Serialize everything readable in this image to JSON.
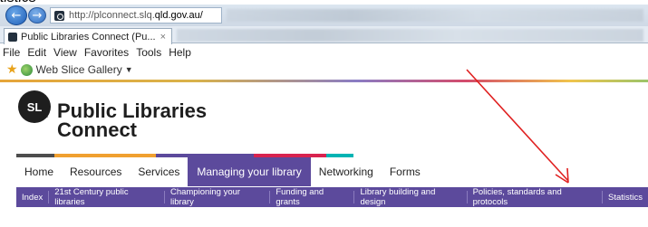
{
  "top_fragment": "tistics",
  "browser": {
    "url_host": "http://plconnect.slq.",
    "url_rest": "qld.gov.au/",
    "tab_title": "Public Libraries Connect (Pu...",
    "tab_close": "×",
    "menu": [
      "File",
      "Edit",
      "View",
      "Favorites",
      "Tools",
      "Help"
    ],
    "favorites_item": "Web Slice Gallery",
    "back_glyph": "←",
    "forward_glyph": "→"
  },
  "site": {
    "logo_text": "SL",
    "title_line1": "Public Libraries",
    "title_line2": "Connect",
    "nav": [
      {
        "label": "Home",
        "active": false
      },
      {
        "label": "Resources",
        "active": false
      },
      {
        "label": "Services",
        "active": false
      },
      {
        "label": "Managing your library",
        "active": true
      },
      {
        "label": "Networking",
        "active": false
      },
      {
        "label": "Forms",
        "active": false
      }
    ],
    "subnav": [
      "Index",
      "21st Century public libraries",
      "Championing your library",
      "Funding and grants",
      "Library building and design",
      "Policies, standards and protocols",
      "Statistics"
    ]
  },
  "colors": {
    "accent_purple": "#5c4a9c",
    "annotation_arrow": "#e02020",
    "rule_segments": [
      "#4d4d4d",
      "#f0a030",
      "#5c4a9c",
      "#d8234f",
      "#00b4b4"
    ]
  },
  "icons": {
    "back": "back-arrow-icon",
    "forward": "forward-arrow-icon",
    "favorites": "favorites-star-icon",
    "web_slice": "web-slice-icon",
    "annotation": "red-arrow-annotation"
  }
}
